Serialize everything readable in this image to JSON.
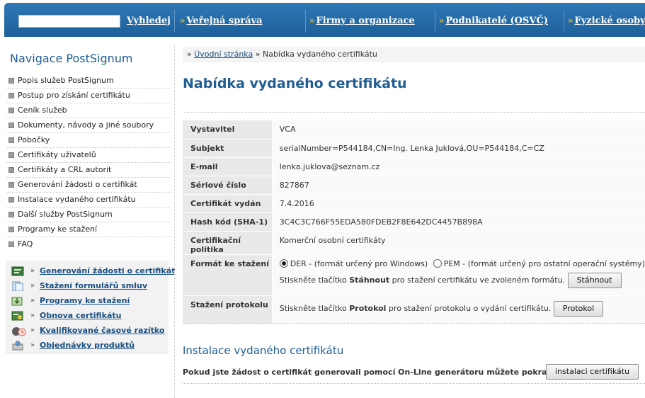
{
  "topbar": {
    "search_placeholder": "",
    "search_button": "Vyhledej",
    "nav": [
      {
        "arrow": "»",
        "label": "Veřejná správa"
      },
      {
        "arrow": "»",
        "label": "Firmy a organizace"
      },
      {
        "arrow": "»",
        "label": "Podnikatelé (OSVČ)"
      },
      {
        "arrow": "»",
        "label": "Fyzické osoby"
      }
    ]
  },
  "sidebar": {
    "title": "Navigace PostSignum",
    "items": [
      "Popis služeb PostSignum",
      "Postup pro získání certifikátu",
      "Ceník služeb",
      "Dokumenty, návody a jiné soubory",
      "Pobočky",
      "Certifikáty uživatelů",
      "Certifikáty a CRL autorit",
      "Generování žádosti o certifikát",
      "Instalace vydaného certifikátu",
      "Další služby PostSignum",
      "Programy ke stažení",
      "FAQ"
    ],
    "quick_links": [
      {
        "icon": "generate-request-icon",
        "label": "Generování žádosti o certifikát"
      },
      {
        "icon": "contract-forms-icon",
        "label": "Stažení formulářů smluv"
      },
      {
        "icon": "download-programs-icon",
        "label": "Programy ke stažení"
      },
      {
        "icon": "certificate-renewal-icon",
        "label": "Obnova certifikátu"
      },
      {
        "icon": "timestamp-icon",
        "label": "Kvalifikované časové razítko"
      },
      {
        "icon": "product-order-icon",
        "label": "Objednávky produktů"
      }
    ]
  },
  "breadcrumb": {
    "prefix": "»",
    "home": "Úvodní stránka",
    "separator": "»",
    "current": "Nabídka vydaného certifikátu"
  },
  "main": {
    "title": "Nabídka vydaného certifikátu",
    "rows": [
      {
        "key": "Vystavitel",
        "value": "VCA"
      },
      {
        "key": "Subjekt",
        "value": "serialNumber=P544184,CN=Ing. Lenka Juklová,OU=P544184,C=CZ"
      },
      {
        "key": "E-mail",
        "value": "lenka.juklova@seznam.cz"
      },
      {
        "key": "Sériové číslo",
        "value": "827867"
      },
      {
        "key": "Certifikát vydán",
        "value": "7.4.2016"
      },
      {
        "key": "Hash kód (SHA-1)",
        "value": "3C4C3C766F55EDA580FDEB2F8E642DC4457B898A"
      },
      {
        "key": "Certifikační politika",
        "value": "Komerční osobní certifikáty"
      }
    ],
    "format": {
      "key": "Formát ke stažení",
      "option_der": "DER - (formát určený pro Windows)",
      "option_pem": "PEM - (formát určený pro ostatní operační systémy)",
      "selected": "DER",
      "hint_before": "Stiskněte tlačítko ",
      "hint_bold": "Stáhnout",
      "hint_after": " pro stažení certifikátu ve zvoleném formátu.",
      "button": "Stáhnout"
    },
    "protocol": {
      "key": "Stažení protokolu",
      "hint_before": "Stiskněte tlačítko ",
      "hint_bold": "Protokol",
      "hint_after": " pro stažení protokolu o vydání certifikátu.",
      "button": "Protokol"
    },
    "install": {
      "title": "Instalace vydaného certifikátu",
      "text": "Pokud jste žádost o certifikát generovali pomocí On-Line generátoru můžete pokračovat k",
      "button": "instalaci certifikátu"
    }
  },
  "colors": {
    "topbar": "#1d5f99",
    "accent": "#1f5d94",
    "arrow": "#f6b500",
    "key_cell": "#e9e9e9"
  }
}
